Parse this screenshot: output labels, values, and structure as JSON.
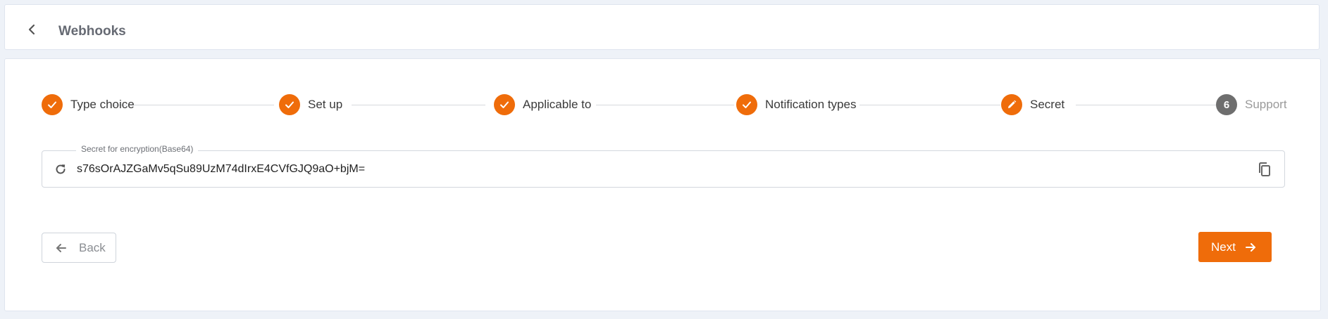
{
  "header": {
    "title": "Webhooks"
  },
  "steps": [
    {
      "label": "Type choice",
      "status": "done",
      "icon": "check-icon"
    },
    {
      "label": "Set up",
      "status": "done",
      "icon": "check-icon"
    },
    {
      "label": "Applicable to",
      "status": "done",
      "icon": "check-icon"
    },
    {
      "label": "Notification types",
      "status": "done",
      "icon": "check-icon"
    },
    {
      "label": "Secret",
      "status": "active",
      "icon": "pencil-icon"
    },
    {
      "label": "Support",
      "status": "pending",
      "number": "6"
    }
  ],
  "secret": {
    "label": "Secret for encryption(Base64)",
    "value": "s76sOrAJZGaMv5qSu89UzM74dIrxE4CVfGJQ9aO+bjM="
  },
  "buttons": {
    "back": "Back",
    "next": "Next"
  },
  "colors": {
    "accent": "#ef6c0a",
    "inactive_step": "#6e6e6e"
  }
}
